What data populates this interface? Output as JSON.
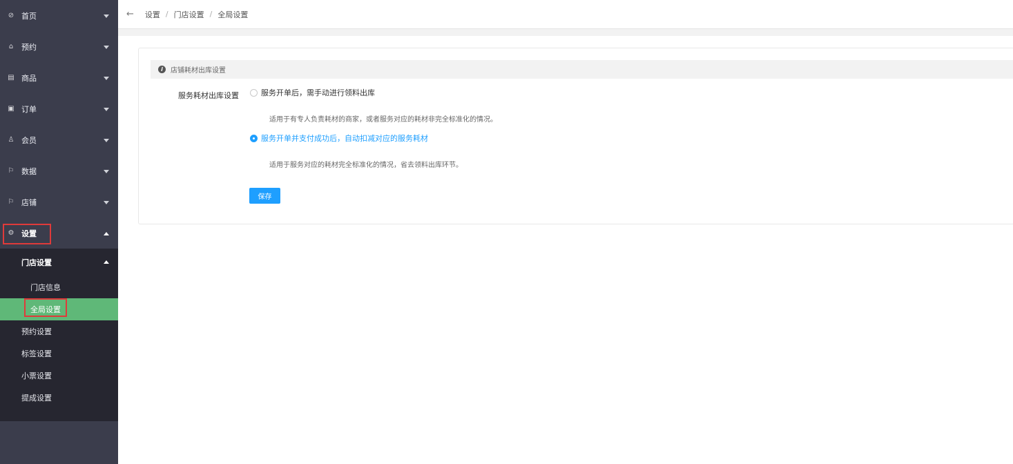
{
  "sidebar": {
    "items": [
      {
        "label": "首页",
        "icon": "dashboard-icon",
        "glyph": "⊘"
      },
      {
        "label": "预约",
        "icon": "home-icon",
        "glyph": "⌂"
      },
      {
        "label": "商品",
        "icon": "document-icon",
        "glyph": "▤"
      },
      {
        "label": "订单",
        "icon": "order-icon",
        "glyph": "▣"
      },
      {
        "label": "会员",
        "icon": "users-icon",
        "glyph": "♙"
      },
      {
        "label": "数据",
        "icon": "flag-icon",
        "glyph": "⚐"
      },
      {
        "label": "店铺",
        "icon": "flag-icon",
        "glyph": "⚐"
      },
      {
        "label": "设置",
        "icon": "gear-icon",
        "glyph": "⚙"
      }
    ],
    "submenu": {
      "group_label": "门店设置",
      "group_children": [
        "门店信息",
        "全局设置"
      ],
      "items": [
        "预约设置",
        "标签设置",
        "小票设置",
        "提成设置"
      ]
    }
  },
  "header": {
    "back_glyph": "←",
    "breadcrumb": [
      "设置",
      "门店设置",
      "全局设置"
    ],
    "separator": "/"
  },
  "main": {
    "section_title": "店铺耗材出库设置",
    "info_glyph": "i",
    "field_label": "服务耗材出库设置",
    "options": [
      {
        "label": "服务开单后，需手动进行领料出库",
        "desc": "适用于有专人负责耗材的商家，或者服务对应的耗材非完全标准化的情况。",
        "checked": false
      },
      {
        "label": "服务开单并支付成功后，自动扣减对应的服务耗材",
        "desc": "适用于服务对应的耗材完全标准化的情况，省去领料出库环节。",
        "checked": true
      }
    ],
    "save_label": "保存"
  },
  "colors": {
    "sidebar_bg": "#3b3d4c",
    "submenu_bg": "#262630",
    "active_green": "#5fb878",
    "accent_blue": "#1e9fff",
    "highlight_red": "#e03a3a"
  }
}
